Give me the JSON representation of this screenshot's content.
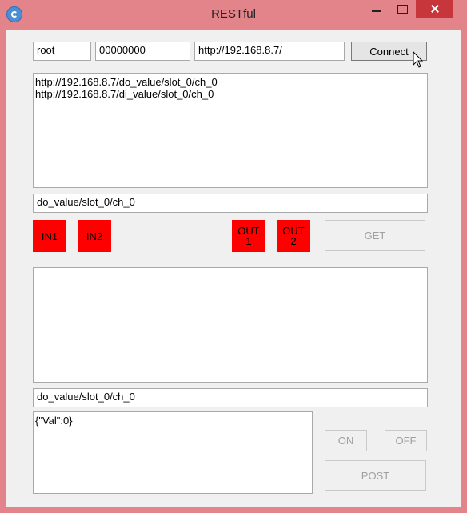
{
  "window": {
    "title": "RESTful",
    "app_icon": "app-logo-icon"
  },
  "login": {
    "username": "root",
    "password": "00000000",
    "url": "http://192.168.8.7/"
  },
  "connect_label": "Connect",
  "endpoints_list": [
    "http://192.168.8.7/do_value/slot_0/ch_0",
    "http://192.168.8.7/di_value/slot_0/ch_0"
  ],
  "get_path": "do_value/slot_0/ch_0",
  "indicators": {
    "in1": "IN1",
    "in2": "IN2",
    "out1": "OUT\n1",
    "out2": "OUT\n2",
    "color": "#ff0000"
  },
  "get_label": "GET",
  "get_response": "",
  "post_path": "do_value/slot_0/ch_0",
  "post_body": "{\"Val\":0}",
  "on_label": "ON",
  "off_label": "OFF",
  "post_label": "POST",
  "colors": {
    "titlebar": "#e3838a",
    "close_button": "#c7363b"
  }
}
